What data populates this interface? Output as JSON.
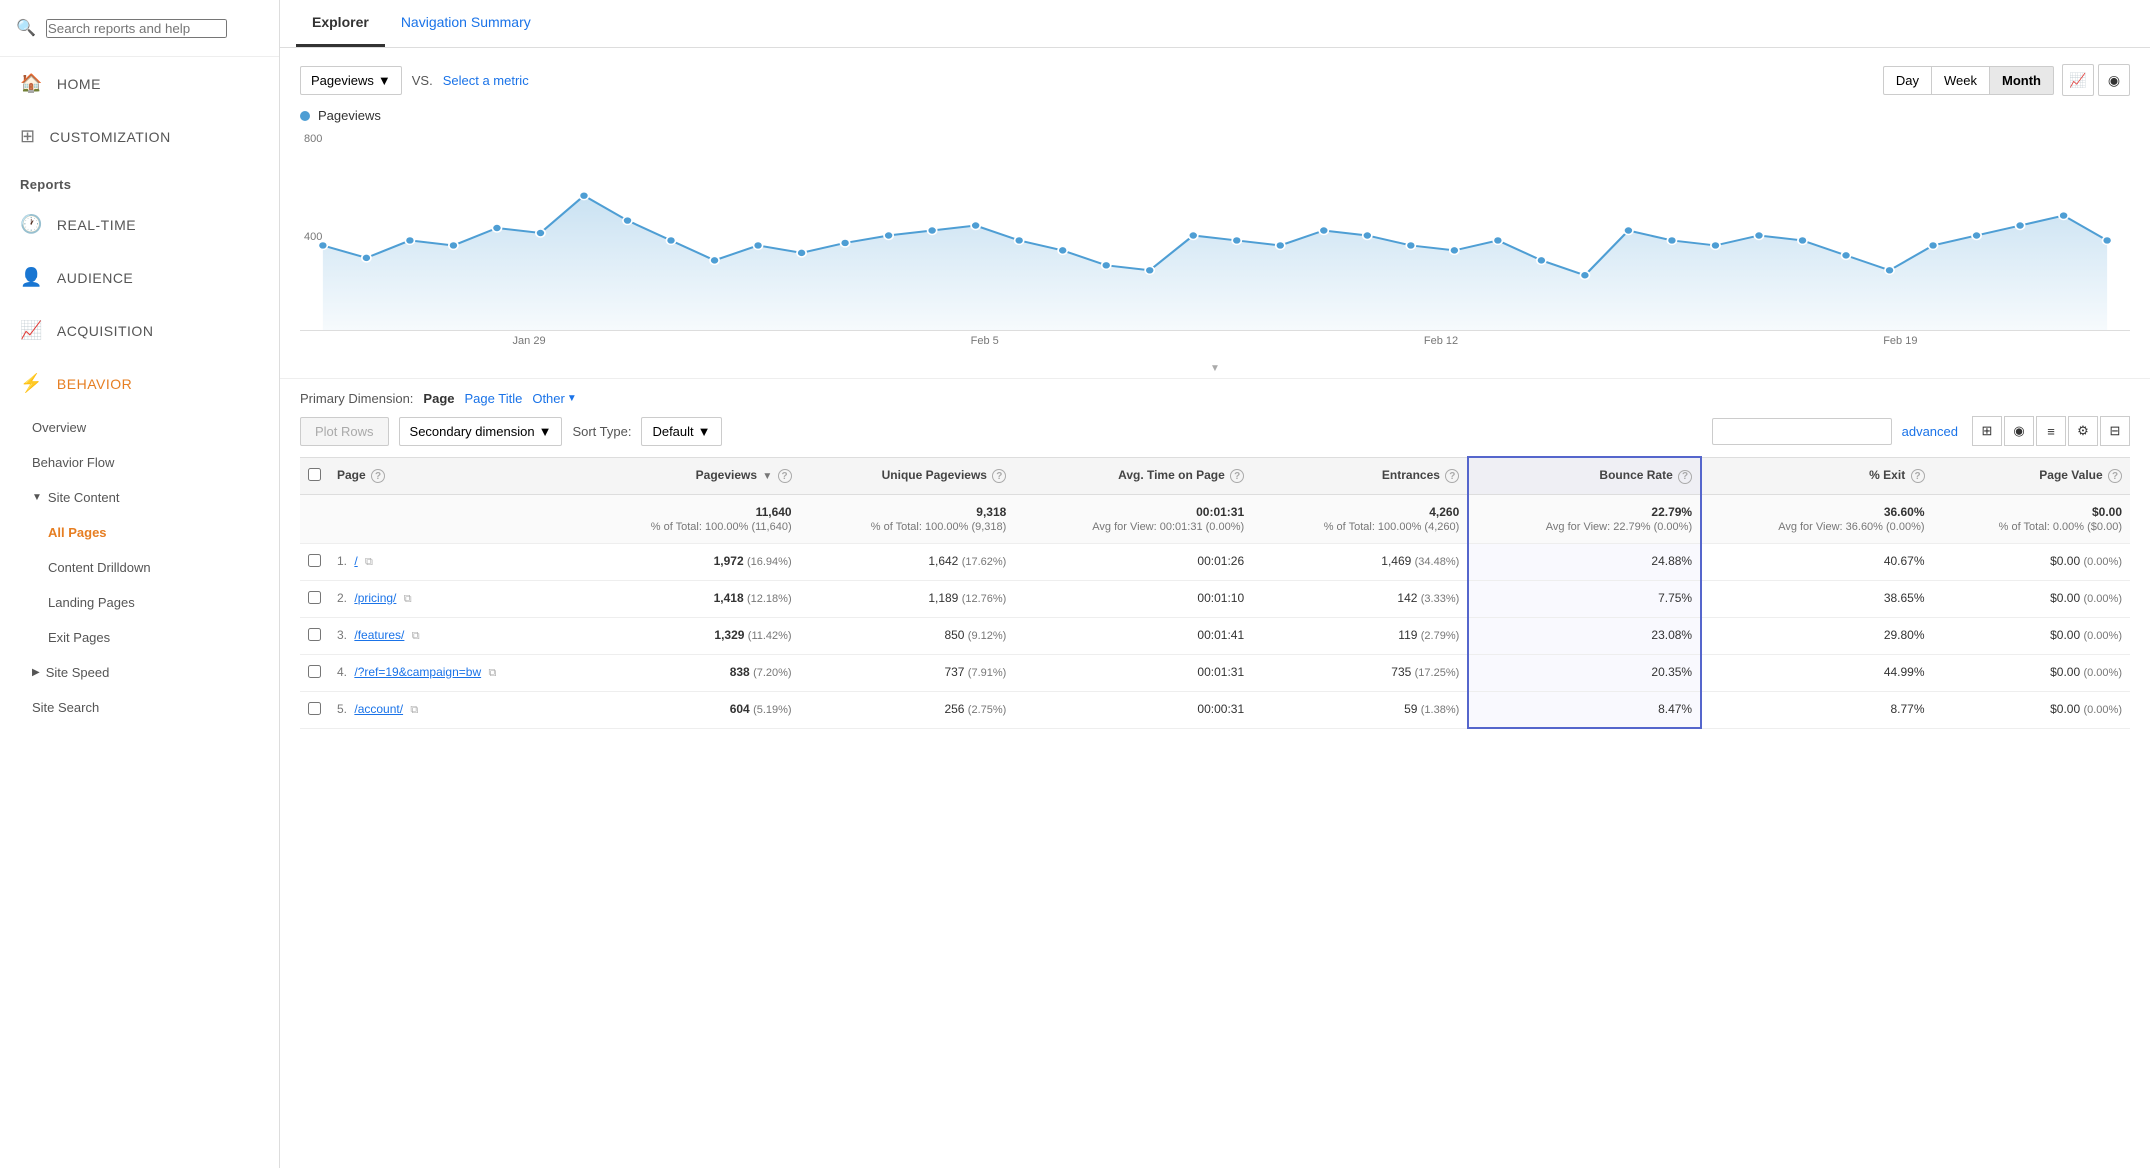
{
  "sidebar": {
    "search_placeholder": "Search reports and help",
    "nav_items": [
      {
        "id": "home",
        "label": "HOME",
        "icon": "🏠"
      },
      {
        "id": "customization",
        "label": "CUSTOMIZATION",
        "icon": "⊞"
      }
    ],
    "reports_label": "Reports",
    "report_sections": [
      {
        "id": "realtime",
        "label": "REAL-TIME",
        "icon": "🕐"
      },
      {
        "id": "audience",
        "label": "AUDIENCE",
        "icon": "👤"
      },
      {
        "id": "acquisition",
        "label": "ACQUISITION",
        "icon": "📈"
      },
      {
        "id": "behavior",
        "label": "BEHAVIOR",
        "icon": "⚡",
        "active": true
      }
    ],
    "behavior_sub": [
      {
        "id": "overview",
        "label": "Overview"
      },
      {
        "id": "behavior-flow",
        "label": "Behavior Flow"
      },
      {
        "id": "site-content",
        "label": "Site Content",
        "expandable": true
      },
      {
        "id": "all-pages",
        "label": "All Pages",
        "active": true
      },
      {
        "id": "content-drilldown",
        "label": "Content Drilldown"
      },
      {
        "id": "landing-pages",
        "label": "Landing Pages"
      },
      {
        "id": "exit-pages",
        "label": "Exit Pages"
      },
      {
        "id": "site-speed",
        "label": "Site Speed",
        "expandable": true
      },
      {
        "id": "site-search",
        "label": "Site Search"
      }
    ]
  },
  "tabs": [
    {
      "id": "explorer",
      "label": "Explorer",
      "active": true
    },
    {
      "id": "navigation-summary",
      "label": "Navigation Summary",
      "active": false
    }
  ],
  "metric_selector": {
    "selected_metric": "Pageviews",
    "vs_label": "VS.",
    "select_metric_label": "Select a metric"
  },
  "time_buttons": [
    {
      "id": "day",
      "label": "Day"
    },
    {
      "id": "week",
      "label": "Week"
    },
    {
      "id": "month",
      "label": "Month",
      "active": true
    }
  ],
  "chart": {
    "y_label": "800",
    "y_label2": "400",
    "legend_label": "Pageviews",
    "x_labels": [
      "Jan 29",
      "Feb 5",
      "Feb 12",
      "Feb 19"
    ],
    "data_points": [
      410,
      385,
      420,
      410,
      445,
      435,
      510,
      460,
      420,
      380,
      410,
      395,
      415,
      430,
      440,
      450,
      420,
      400,
      370,
      360,
      430,
      420,
      410,
      440,
      430,
      410,
      400,
      420,
      380,
      350,
      440,
      420,
      410,
      430,
      420,
      390,
      360,
      410,
      430,
      450,
      470,
      420
    ]
  },
  "primary_dimension": {
    "label": "Primary Dimension:",
    "options": [
      {
        "id": "page",
        "label": "Page",
        "active": true
      },
      {
        "id": "page-title",
        "label": "Page Title",
        "link": true
      },
      {
        "id": "other",
        "label": "Other",
        "dropdown": true
      }
    ]
  },
  "table_controls": {
    "plot_rows_label": "Plot Rows",
    "secondary_dim_label": "Secondary dimension",
    "sort_type_label": "Sort Type:",
    "sort_type_value": "Default",
    "advanced_label": "advanced"
  },
  "table_columns": [
    {
      "id": "page",
      "label": "Page",
      "help": true
    },
    {
      "id": "pageviews",
      "label": "Pageviews",
      "help": true,
      "sort": true
    },
    {
      "id": "unique-pageviews",
      "label": "Unique Pageviews",
      "help": true
    },
    {
      "id": "avg-time",
      "label": "Avg. Time on Page",
      "help": true
    },
    {
      "id": "entrances",
      "label": "Entrances",
      "help": true
    },
    {
      "id": "bounce-rate",
      "label": "Bounce Rate",
      "help": true,
      "highlight": true
    },
    {
      "id": "pct-exit",
      "label": "% Exit",
      "help": true
    },
    {
      "id": "page-value",
      "label": "Page Value",
      "help": true
    }
  ],
  "table_totals": {
    "pageviews": "11,640",
    "pageviews_sub": "% of Total: 100.00% (11,640)",
    "unique_pageviews": "9,318",
    "unique_pageviews_sub": "% of Total: 100.00% (9,318)",
    "avg_time": "00:01:31",
    "avg_time_sub": "Avg for View: 00:01:31 (0.00%)",
    "entrances": "4,260",
    "entrances_sub": "% of Total: 100.00% (4,260)",
    "bounce_rate": "22.79%",
    "bounce_rate_sub": "Avg for View: 22.79% (0.00%)",
    "pct_exit": "36.60%",
    "pct_exit_sub": "Avg for View: 36.60% (0.00%)",
    "page_value": "$0.00",
    "page_value_sub": "% of Total: 0.00% ($0.00)"
  },
  "table_rows": [
    {
      "num": "1",
      "page": "/",
      "pageviews": "1,972",
      "pageviews_pct": "(16.94%)",
      "unique_pv": "1,642",
      "unique_pv_pct": "(17.62%)",
      "avg_time": "00:01:26",
      "entrances": "1,469",
      "entrances_pct": "(34.48%)",
      "bounce_rate": "24.88%",
      "pct_exit": "40.67%",
      "page_value": "$0.00",
      "page_value_pct": "(0.00%)"
    },
    {
      "num": "2",
      "page": "/pricing/",
      "pageviews": "1,418",
      "pageviews_pct": "(12.18%)",
      "unique_pv": "1,189",
      "unique_pv_pct": "(12.76%)",
      "avg_time": "00:01:10",
      "entrances": "142",
      "entrances_pct": "(3.33%)",
      "bounce_rate": "7.75%",
      "pct_exit": "38.65%",
      "page_value": "$0.00",
      "page_value_pct": "(0.00%)"
    },
    {
      "num": "3",
      "page": "/features/",
      "pageviews": "1,329",
      "pageviews_pct": "(11.42%)",
      "unique_pv": "850",
      "unique_pv_pct": "(9.12%)",
      "avg_time": "00:01:41",
      "entrances": "119",
      "entrances_pct": "(2.79%)",
      "bounce_rate": "23.08%",
      "pct_exit": "29.80%",
      "page_value": "$0.00",
      "page_value_pct": "(0.00%)"
    },
    {
      "num": "4",
      "page": "/?ref=19&campaign=bw",
      "pageviews": "838",
      "pageviews_pct": "(7.20%)",
      "unique_pv": "737",
      "unique_pv_pct": "(7.91%)",
      "avg_time": "00:01:31",
      "entrances": "735",
      "entrances_pct": "(17.25%)",
      "bounce_rate": "20.35%",
      "pct_exit": "44.99%",
      "page_value": "$0.00",
      "page_value_pct": "(0.00%)"
    },
    {
      "num": "5",
      "page": "/account/",
      "pageviews": "604",
      "pageviews_pct": "(5.19%)",
      "unique_pv": "256",
      "unique_pv_pct": "(2.75%)",
      "avg_time": "00:00:31",
      "entrances": "59",
      "entrances_pct": "(1.38%)",
      "bounce_rate": "8.47%",
      "pct_exit": "8.77%",
      "page_value": "$0.00",
      "page_value_pct": "(0.00%)"
    }
  ]
}
